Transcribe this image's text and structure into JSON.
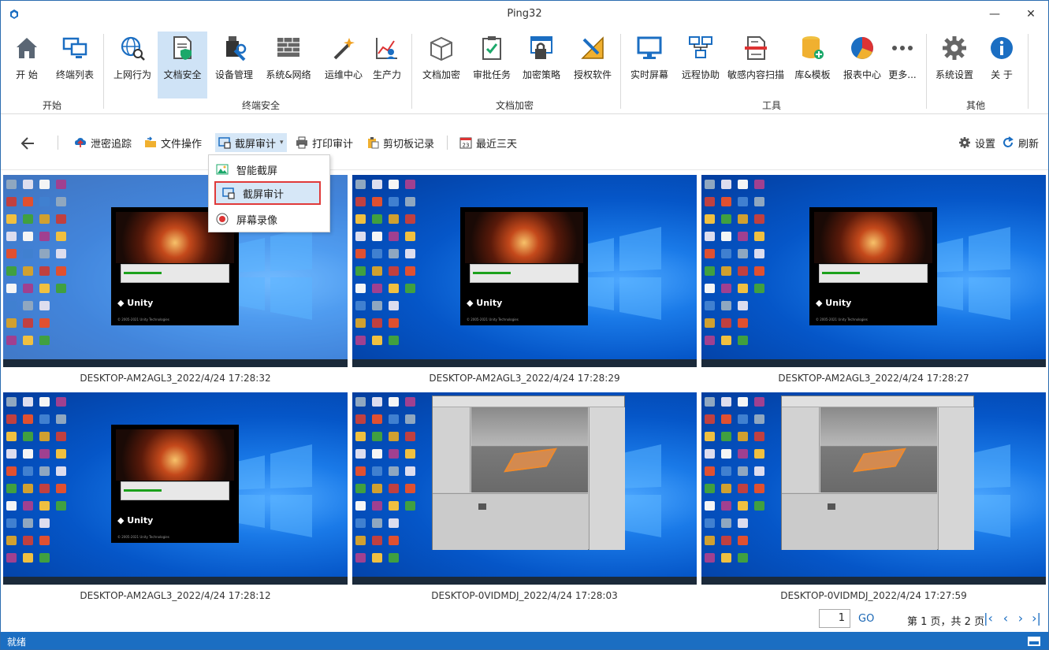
{
  "window": {
    "title": "Ping32",
    "minimize": "—",
    "maximize": "☐",
    "close": "✕"
  },
  "ribbon": {
    "buttons": [
      {
        "label": "开  始",
        "icon": "home-icon"
      },
      {
        "label": "终端列表",
        "icon": "computers-icon"
      },
      {
        "label": "上网行为",
        "icon": "globe-search-icon"
      },
      {
        "label": "文档安全",
        "icon": "document-shield-icon"
      },
      {
        "label": "设备管理",
        "icon": "usb-tools-icon"
      },
      {
        "label": "系统&网络",
        "icon": "firewall-icon"
      },
      {
        "label": "运维中心",
        "icon": "magic-wand-icon"
      },
      {
        "label": "生产力",
        "icon": "productivity-chart-icon"
      },
      {
        "label": "文档加密",
        "icon": "box-encrypt-icon"
      },
      {
        "label": "审批任务",
        "icon": "clipboard-check-icon"
      },
      {
        "label": "加密策略",
        "icon": "lock-window-icon"
      },
      {
        "label": "授权软件",
        "icon": "ruler-pencil-icon"
      },
      {
        "label": "实时屏幕",
        "icon": "monitor-icon"
      },
      {
        "label": "远程协助",
        "icon": "remote-network-icon"
      },
      {
        "label": "敏感内容扫描",
        "icon": "document-scan-icon"
      },
      {
        "label": "库&模板",
        "icon": "database-icon"
      },
      {
        "label": "报表中心",
        "icon": "pie-chart-icon"
      },
      {
        "label": "更多...",
        "icon": "more-dots-icon"
      },
      {
        "label": "系统设置",
        "icon": "gear-icon"
      },
      {
        "label": "关  于",
        "icon": "info-icon"
      }
    ],
    "groups": [
      "开始",
      "终端安全",
      "文档加密",
      "工具",
      "其他"
    ],
    "active": "文档安全"
  },
  "toolbar": {
    "back": "←",
    "items": [
      "泄密追踪",
      "文件操作",
      "截屏审计",
      "打印审计",
      "剪切板记录",
      "最近三天"
    ],
    "calendar_day": "23",
    "dropdown_arrow": "▾",
    "settings": "设置",
    "refresh": "刷新"
  },
  "dropdown": {
    "items": [
      "智能截屏",
      "截屏审计",
      "屏幕录像"
    ],
    "selected": "截屏审计"
  },
  "screenshots": [
    {
      "caption": "DESKTOP-AM2AGL3_2022/4/24 17:28:32",
      "content": "unity-splash"
    },
    {
      "caption": "DESKTOP-AM2AGL3_2022/4/24 17:28:29",
      "content": "unity-splash"
    },
    {
      "caption": "DESKTOP-AM2AGL3_2022/4/24 17:28:27",
      "content": "unity-splash"
    },
    {
      "caption": "DESKTOP-AM2AGL3_2022/4/24 17:28:12",
      "content": "unity-splash"
    },
    {
      "caption": "DESKTOP-0VIDMDJ_2022/4/24 17:28:03",
      "content": "unity-editor"
    },
    {
      "caption": "DESKTOP-0VIDMDJ_2022/4/24 17:27:59",
      "content": "unity-editor"
    }
  ],
  "unity": {
    "logo": "Unity",
    "copyright": "© 2005-2021 Unity Technologies"
  },
  "pager": {
    "page_value": "1",
    "go": "GO",
    "info": "第 1 页，共 2 页",
    "first": "|‹",
    "prev": "‹",
    "next": "›",
    "last": "›|"
  },
  "status": {
    "text": "就绪"
  },
  "colors": {
    "accent": "#1b6ec2",
    "active_ribbon": "#cfe3f6",
    "dropdown_highlight_border": "#e03a3a"
  }
}
